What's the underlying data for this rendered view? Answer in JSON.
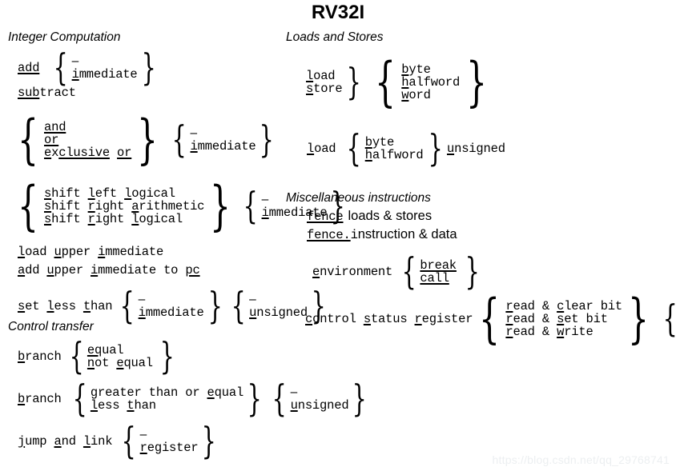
{
  "title": "RV32I",
  "watermark": "https://blog.csdn.net/qq_29768741",
  "sections": {
    "integer_computation": "Integer Computation",
    "control_transfer": "Control transfer",
    "loads_and_stores": "Loads and Stores",
    "miscellaneous": "Miscellaneous instructions"
  },
  "labels": {
    "add": "add",
    "subtract": "subtract",
    "and": "and",
    "or": "or",
    "exclusive_or": "exclusive or",
    "shift_left_logical": "shift left logical",
    "shift_right_arithmetic": "shift right arithmetic",
    "shift_right_logical": "shift right logical",
    "load_upper_immediate": "load upper immediate",
    "add_upper_immediate_to_pc": "add upper immediate to pc",
    "set_less_than": "set less than",
    "branch": "branch",
    "equal": "equal",
    "not_equal": "not equal",
    "greater_than_or_equal": "greater than or equal",
    "less_than": "less than",
    "jump_and_link": "jump and link",
    "register": "register",
    "load": "load",
    "store": "store",
    "byte": "byte",
    "halfword": "halfword",
    "word": "word",
    "unsigned": "unsigned",
    "immediate": "immediate",
    "fence": "fence",
    "fence_dot_i": "fence.i",
    "loads_and_stores_operands": "loads & stores",
    "instruction_and_data": "instruction & data",
    "environment": "environment",
    "break": "break",
    "call": "call",
    "control_status_register": "control status register",
    "read_and_clear_bit": "read & clear bit",
    "read_and_set_bit": "read & set bit",
    "read_and_write": "read & write",
    "none": "–"
  }
}
